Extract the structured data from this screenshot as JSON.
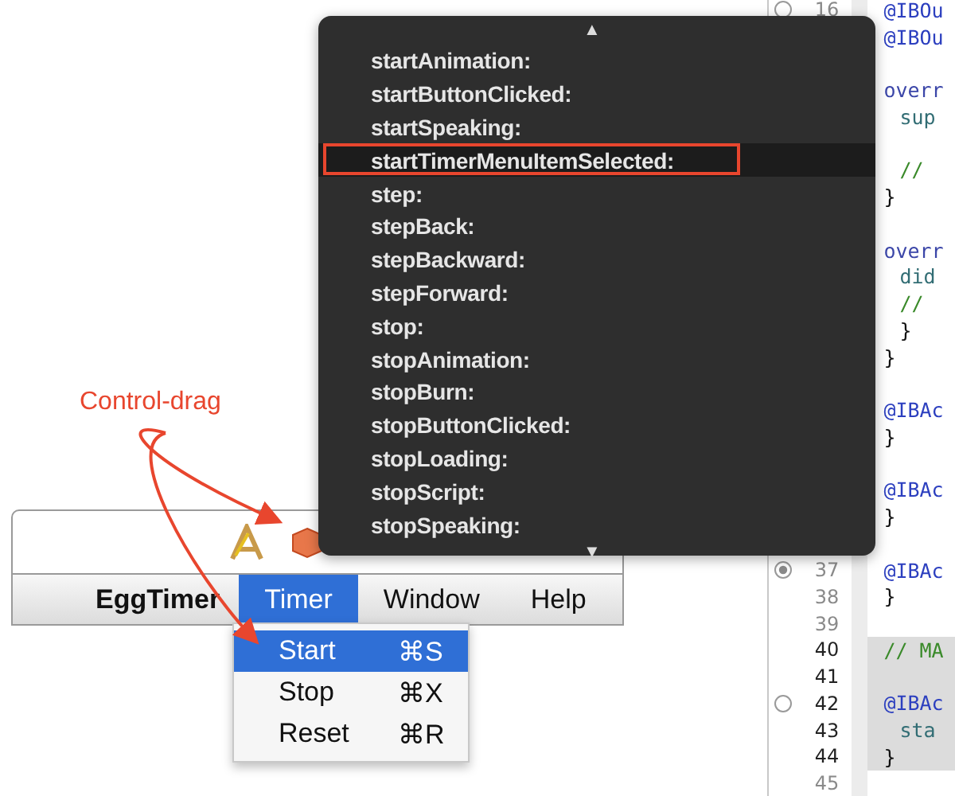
{
  "popup": {
    "scroll_up": "▲",
    "scroll_down": "▼",
    "items": [
      {
        "label": "startAnimation:",
        "selected": false
      },
      {
        "label": "startButtonClicked:",
        "selected": false
      },
      {
        "label": "startSpeaking:",
        "selected": false
      },
      {
        "label": "startTimerMenuItemSelected:",
        "selected": true
      },
      {
        "label": "step:",
        "selected": false
      },
      {
        "label": "stepBack:",
        "selected": false
      },
      {
        "label": "stepBackward:",
        "selected": false
      },
      {
        "label": "stepForward:",
        "selected": false
      },
      {
        "label": "stop:",
        "selected": false
      },
      {
        "label": "stopAnimation:",
        "selected": false
      },
      {
        "label": "stopBurn:",
        "selected": false
      },
      {
        "label": "stopButtonClicked:",
        "selected": false
      },
      {
        "label": "stopLoading:",
        "selected": false
      },
      {
        "label": "stopScript:",
        "selected": false
      },
      {
        "label": "stopSpeaking:",
        "selected": false
      }
    ]
  },
  "annotation": {
    "label": "Control-drag"
  },
  "window": {
    "menu_bar": [
      {
        "label": "EggTimer",
        "kind": "app",
        "selected": false
      },
      {
        "label": "Timer",
        "kind": "menu",
        "selected": true
      },
      {
        "label": "Window",
        "kind": "menu",
        "selected": false
      },
      {
        "label": "Help",
        "kind": "menu",
        "selected": false
      }
    ],
    "menu": [
      {
        "label": "Start",
        "shortcut": "⌘S",
        "selected": true
      },
      {
        "label": "Stop",
        "shortcut": "⌘X",
        "selected": false
      },
      {
        "label": "Reset",
        "shortcut": "⌘R",
        "selected": false
      }
    ]
  },
  "editor": {
    "lines": [
      {
        "number": "16",
        "code": "@IBOu",
        "kind": "attribute",
        "breakpoint": true,
        "highlighted": false
      },
      {
        "code": "@IBOu",
        "kind": "attribute",
        "highlighted": false
      },
      {
        "highlighted": false
      },
      {
        "code": "overr",
        "kind": "keyword",
        "highlighted": false
      },
      {
        "code": "sup",
        "kind": "call",
        "indent": true,
        "highlighted": false
      },
      {
        "highlighted": false
      },
      {
        "code": "//",
        "kind": "comment",
        "indent": true,
        "highlighted": false
      },
      {
        "code": "}",
        "kind": "plain",
        "highlighted": false
      },
      {
        "highlighted": false
      },
      {
        "code": "overr",
        "kind": "keyword",
        "highlighted": false
      },
      {
        "code": "did",
        "kind": "call",
        "indent": true,
        "highlighted": false
      },
      {
        "code": "//",
        "kind": "comment",
        "indent": true,
        "highlighted": false
      },
      {
        "code": "}",
        "kind": "plain",
        "indent": true,
        "highlighted": false
      },
      {
        "code": "}",
        "kind": "plain",
        "highlighted": false
      },
      {
        "highlighted": false
      },
      {
        "code": "@IBAc",
        "kind": "attribute",
        "highlighted": false
      },
      {
        "code": "}",
        "kind": "plain",
        "highlighted": false
      },
      {
        "highlighted": false
      },
      {
        "code": "@IBAc",
        "kind": "attribute",
        "highlighted": false
      },
      {
        "code": "}",
        "kind": "plain",
        "highlighted": false
      },
      {
        "highlighted": false
      },
      {
        "number": "37",
        "code": "@IBAc",
        "kind": "attribute",
        "breakpoint": true,
        "breakpoint_active": true,
        "highlighted": false
      },
      {
        "number": "38",
        "code": "}",
        "kind": "plain",
        "highlighted": false
      },
      {
        "number": "39",
        "highlighted": false
      },
      {
        "number": "40",
        "code": "// MA",
        "kind": "comment",
        "highlighted": true
      },
      {
        "number": "41",
        "highlighted": true
      },
      {
        "number": "42",
        "code": "@IBAc",
        "kind": "attribute",
        "breakpoint": true,
        "highlighted": true
      },
      {
        "number": "43",
        "code": "sta",
        "kind": "call",
        "indent": true,
        "highlighted": true
      },
      {
        "number": "44",
        "code": "}",
        "kind": "plain",
        "highlighted": true
      },
      {
        "number": "45",
        "highlighted": false
      }
    ]
  }
}
